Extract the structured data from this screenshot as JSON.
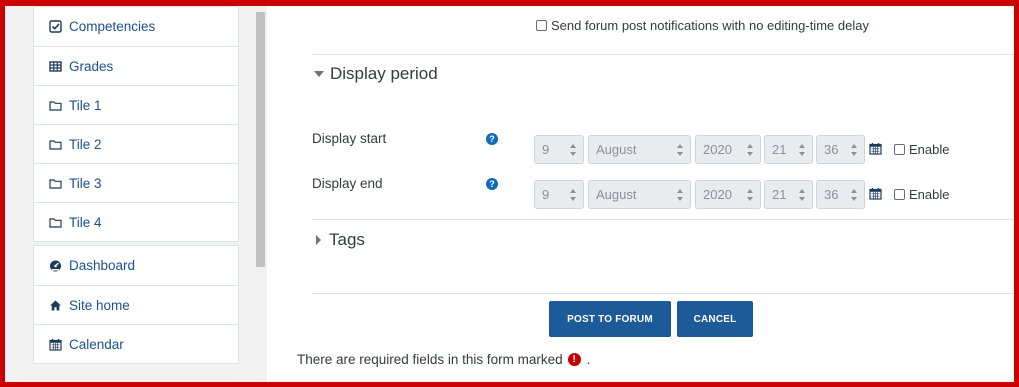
{
  "sidebar": {
    "group1": [
      {
        "label": "Competencies",
        "icon": "check-square-icon"
      },
      {
        "label": "Grades",
        "icon": "table-icon"
      },
      {
        "label": "Tile 1",
        "icon": "folder-icon"
      },
      {
        "label": "Tile 2",
        "icon": "folder-icon"
      },
      {
        "label": "Tile 3",
        "icon": "folder-icon"
      },
      {
        "label": "Tile 4",
        "icon": "folder-icon"
      }
    ],
    "group2": [
      {
        "label": "Dashboard",
        "icon": "tachometer-icon"
      },
      {
        "label": "Site home",
        "icon": "home-icon"
      },
      {
        "label": "Calendar",
        "icon": "calendar-icon"
      }
    ]
  },
  "form": {
    "notify_label": "Send forum post notifications with no editing-time delay",
    "display_period_heading": "Display period",
    "display_start": {
      "label": "Display start",
      "day": "9",
      "month": "August",
      "year": "2020",
      "hour": "21",
      "minute": "36",
      "enable_label": "Enable"
    },
    "display_end": {
      "label": "Display end",
      "day": "9",
      "month": "August",
      "year": "2020",
      "hour": "21",
      "minute": "36",
      "enable_label": "Enable"
    },
    "tags_heading": "Tags",
    "post_button": "POST TO FORUM",
    "cancel_button": "CANCEL",
    "required_note": "There are required fields in this form marked",
    "required_suffix": "."
  },
  "colors": {
    "accent": "#1d5a9a",
    "link": "#1d4f91",
    "frame": "#cc0000",
    "required": "#c20000"
  }
}
